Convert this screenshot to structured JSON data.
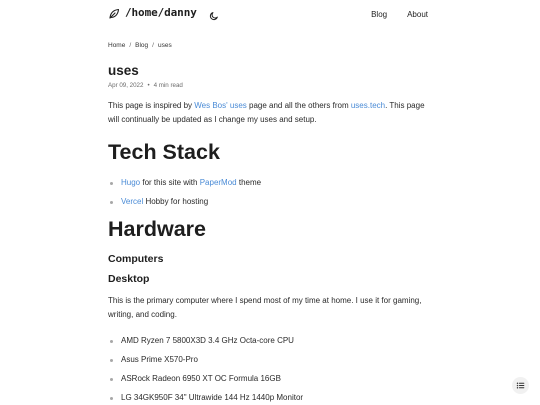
{
  "header": {
    "site_title": "/home/danny",
    "nav": [
      {
        "label": "Blog"
      },
      {
        "label": "About"
      }
    ]
  },
  "breadcrumb": {
    "home": "Home",
    "blog": "Blog",
    "current": "uses",
    "separator": "/"
  },
  "post": {
    "title": "uses",
    "date": "Apr 09, 2022",
    "meta_sep": "•",
    "read_time": "4 min read"
  },
  "intro": {
    "t1": "This page is inspired by ",
    "link1": "Wes Bos' uses",
    "t2": " page and all the others from ",
    "link2": "uses.tech",
    "t3": ". This page will continually be updated as I change my uses and setup."
  },
  "tech_stack": {
    "heading": "Tech Stack",
    "items": [
      {
        "link": "Hugo",
        "mid": " for this site with ",
        "link2": "PaperMod",
        "rest": " theme"
      },
      {
        "link": "Vercel",
        "rest": " Hobby for hosting"
      }
    ]
  },
  "hardware": {
    "heading": "Hardware",
    "computers": "Computers",
    "desktop": "Desktop",
    "desktop_desc": "This is the primary computer where I spend most of my time at home. I use it for gaming, writing, and coding.",
    "parts": [
      "AMD Ryzen 7 5800X3D 3.4 GHz Octa-core CPU",
      "Asus Prime X570-Pro",
      "ASRock Radeon 6950 XT OC Formula 16GB",
      "LG 34GK950F 34\" Ultrawide 144 Hz 1440p Monitor"
    ]
  },
  "colors": {
    "link": "#4a8bd6",
    "text": "#1e1e1e",
    "muted": "#6b6b6b",
    "bullet": "#a8a8a8"
  },
  "icons": {
    "logo": "leaf-icon",
    "theme": "moon-icon",
    "toc": "list-icon"
  }
}
